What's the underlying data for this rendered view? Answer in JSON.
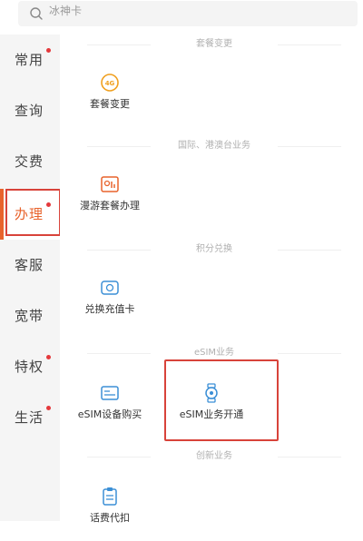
{
  "search": {
    "placeholder": "冰神卡",
    "icon": "search-icon"
  },
  "sidebar": {
    "items": [
      {
        "label": "常用",
        "dot": true
      },
      {
        "label": "查询",
        "dot": false
      },
      {
        "label": "交费",
        "dot": false
      },
      {
        "label": "办理",
        "dot": true,
        "active": true
      },
      {
        "label": "客服",
        "dot": false
      },
      {
        "label": "宽带",
        "dot": false
      },
      {
        "label": "特权",
        "dot": true
      },
      {
        "label": "生活",
        "dot": true
      }
    ]
  },
  "sections": [
    {
      "title": "套餐变更",
      "tiles": [
        {
          "label": "套餐变更",
          "icon": "4g-icon"
        }
      ]
    },
    {
      "title": "国际、港澳台业务",
      "tiles": [
        {
          "label": "漫游套餐办理",
          "icon": "roaming-icon"
        }
      ]
    },
    {
      "title": "积分兑换",
      "tiles": [
        {
          "label": "兑换充值卡",
          "icon": "card-icon"
        }
      ]
    },
    {
      "title": "eSIM业务",
      "tiles": [
        {
          "label": "eSIM设备购买",
          "icon": "esim-card-icon"
        },
        {
          "label": "eSIM业务开通",
          "icon": "watch-icon"
        }
      ]
    },
    {
      "title": "创新业务",
      "tiles": [
        {
          "label": "话费代扣",
          "icon": "clipboard-icon"
        }
      ]
    }
  ],
  "colors": {
    "accent": "#e8632c",
    "highlight": "#d8433a",
    "dot": "#e4393c"
  }
}
